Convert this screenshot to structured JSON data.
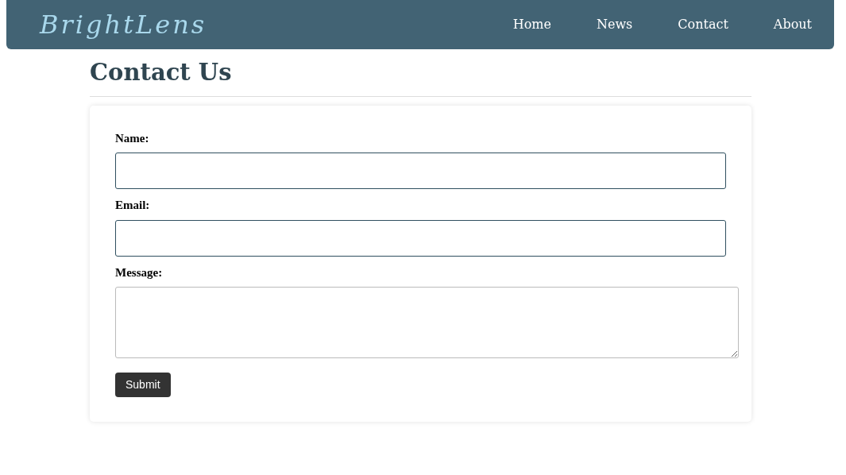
{
  "navbar": {
    "logo": "BrightLens",
    "links": [
      {
        "label": "Home"
      },
      {
        "label": "News"
      },
      {
        "label": "Contact"
      },
      {
        "label": "About"
      }
    ]
  },
  "title": "Contact Us",
  "form": {
    "fields": [
      {
        "label": "Name:",
        "kind": "input"
      },
      {
        "label": "Email:",
        "kind": "input"
      },
      {
        "label": "Message:",
        "kind": "textarea"
      }
    ],
    "submit": "Submit"
  }
}
